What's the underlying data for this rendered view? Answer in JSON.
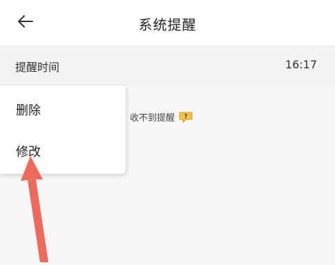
{
  "header": {
    "title": "系统提醒",
    "back_icon": "back-arrow-icon"
  },
  "reminder_row": {
    "label": "提醒时间",
    "value": "16:17"
  },
  "hint": {
    "text": "收不到提醒",
    "help_icon": "question-mark-icon",
    "help_color": "#f0b429"
  },
  "context_menu": {
    "items": [
      {
        "label": "删除"
      },
      {
        "label": "修改"
      }
    ]
  },
  "annotation": {
    "arrow_icon": "red-arrow-pointer",
    "color": "#f06a5c"
  }
}
